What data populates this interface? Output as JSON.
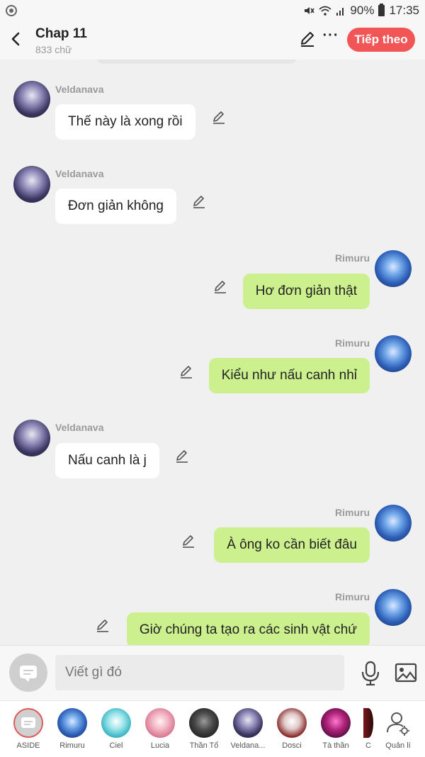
{
  "status_bar": {
    "battery": "90%",
    "time": "17:35",
    "icons": [
      "mute-icon",
      "wifi-icon",
      "signal-icon",
      "battery-icon"
    ]
  },
  "header": {
    "title": "Chap 11",
    "subtitle": "833 chữ",
    "next_label": "Tiếp theo",
    "more_label": "···"
  },
  "messages": [
    {
      "sender": "Veldanava",
      "side": "left",
      "text": "Thế này là xong rồi"
    },
    {
      "sender": "Veldanava",
      "side": "left",
      "text": "Đơn giản không"
    },
    {
      "sender": "Rimuru",
      "side": "right",
      "text": "Hơ đơn giản thật"
    },
    {
      "sender": "Rimuru",
      "side": "right",
      "text": "Kiểu như nấu canh nhỉ"
    },
    {
      "sender": "Veldanava",
      "side": "left",
      "text": "Nấu canh là j"
    },
    {
      "sender": "Rimuru",
      "side": "right",
      "text": "À ông ko cần biết đâu"
    },
    {
      "sender": "Rimuru",
      "side": "right",
      "text": "Giờ chúng ta tạo ra các sinh vật chứ"
    }
  ],
  "input": {
    "placeholder": "Viết gì đó"
  },
  "characters": [
    {
      "label": "ASIDE"
    },
    {
      "label": "Rimuru"
    },
    {
      "label": "Ciel"
    },
    {
      "label": "Lucia"
    },
    {
      "label": "Thần Tổ"
    },
    {
      "label": "Veldana..."
    },
    {
      "label": "Dosci"
    },
    {
      "label": "Tà thần"
    },
    {
      "label": "C"
    },
    {
      "label": "Quản lí"
    }
  ],
  "colors": {
    "accent": "#f25555",
    "right_bubble": "#ccf08e",
    "left_bubble": "#ffffff",
    "background": "#f0f0f0"
  }
}
